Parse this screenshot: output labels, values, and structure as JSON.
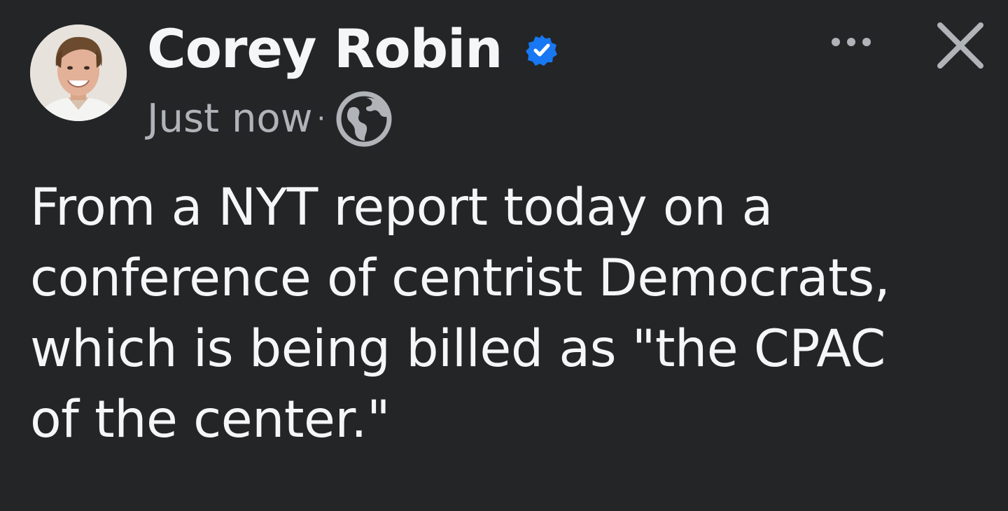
{
  "post": {
    "author": {
      "name": "Corey Robin",
      "verified_icon": "verified-badge-icon",
      "avatar": "profile-photo"
    },
    "meta": {
      "timestamp": "Just now",
      "separator": "·",
      "audience_icon": "globe-icon"
    },
    "actions": {
      "more_icon": "more-options-icon",
      "close_icon": "close-icon"
    },
    "body_text": "From a NYT report today on a\nconference of centrist Democrats,\nwhich is being billed as \"the CPAC\nof the center.\""
  },
  "colors": {
    "background": "#242527",
    "text_primary": "#f5f6f7",
    "text_secondary": "#b0b3b8",
    "verified_blue": "#1877f2"
  }
}
